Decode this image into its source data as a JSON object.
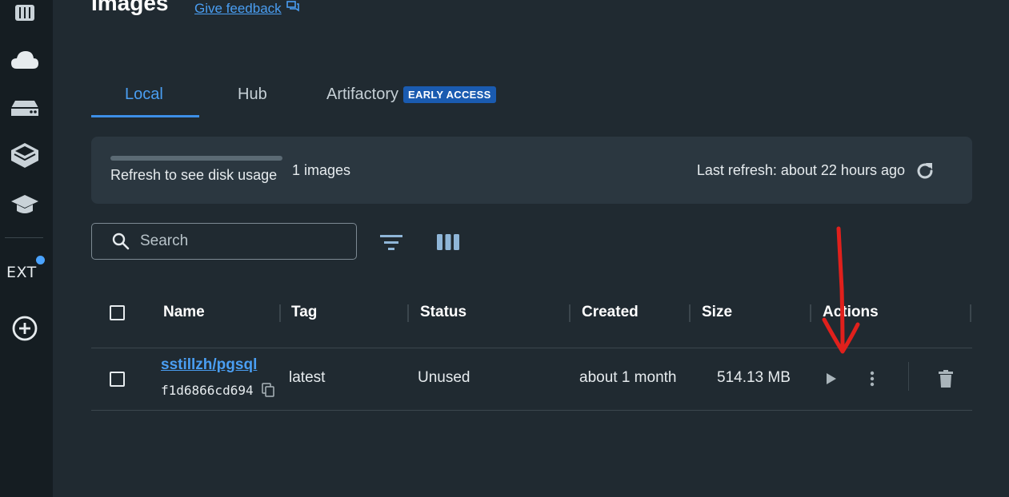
{
  "sidebar": {
    "icons": [
      "containers-icon",
      "cloud-icon",
      "volumes-icon",
      "builds-icon",
      "learn-icon"
    ],
    "ext_label": "EXT",
    "add_icon": "add-extension-icon"
  },
  "header": {
    "title": "Images",
    "feedback_label": "Give feedback"
  },
  "tabs": [
    {
      "label": "Local",
      "active": true
    },
    {
      "label": "Hub",
      "active": false
    },
    {
      "label": "Artifactory",
      "badge": "EARLY ACCESS",
      "active": false
    }
  ],
  "usage": {
    "disk_text": "Refresh to see disk usage",
    "images_count": "1 images",
    "last_refresh": "Last refresh: about 22 hours ago"
  },
  "search": {
    "placeholder": "Search"
  },
  "table": {
    "columns": [
      "Name",
      "Tag",
      "Status",
      "Created",
      "Size",
      "Actions"
    ],
    "rows": [
      {
        "name": "sstillzh/pgsql",
        "image_id": "f1d6866cd694",
        "tag": "latest",
        "status": "Unused",
        "created": "about 1 month",
        "size": "514.13 MB"
      }
    ]
  },
  "colors": {
    "accent": "#4a9ef2",
    "background": "#202a31",
    "sidebar": "#151d22",
    "panel": "#2b3740",
    "annotation": "#e0201c"
  }
}
